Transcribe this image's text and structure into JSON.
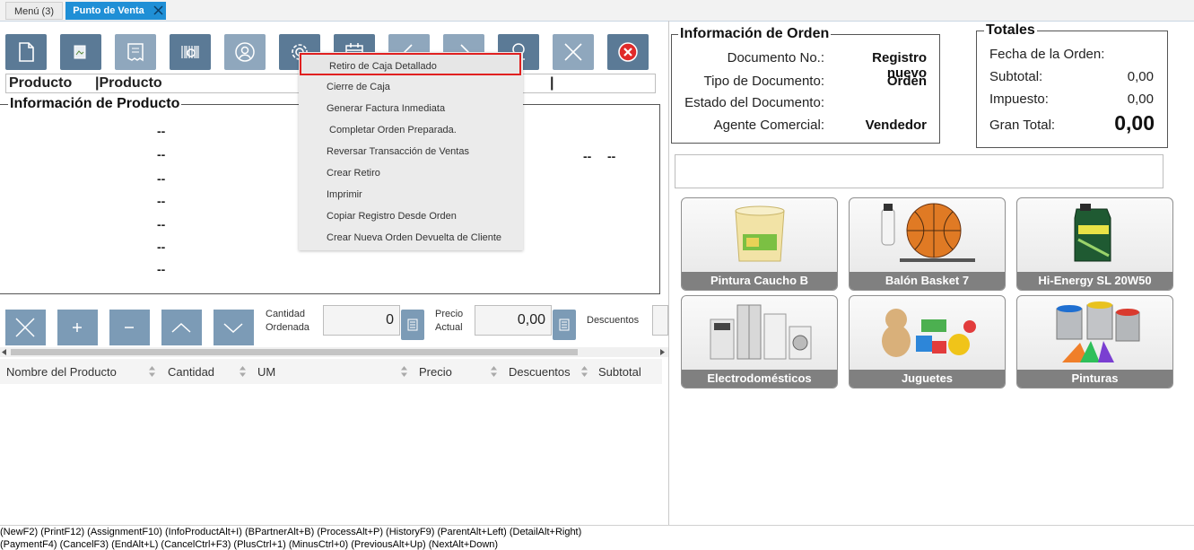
{
  "tabs": {
    "menu": "Menú (3)",
    "pos": "Punto de Venta"
  },
  "product_line": {
    "left": "Producto",
    "right": "Producto"
  },
  "product_info": {
    "title": "Información de Producto",
    "dash": "--"
  },
  "popup_menu": [
    "Retiro de Caja Detallado",
    "Cierre de Caja",
    "Generar Factura Inmediata",
    "Completar Orden Preparada.",
    "Reversar Transacción de Ventas",
    "Crear Retiro",
    "Imprimir",
    "Copiar Registro Desde Orden",
    "Crear Nueva Orden Devuelta de Cliente"
  ],
  "qty": {
    "label1": "Cantidad",
    "label2": "Ordenada",
    "value": "0"
  },
  "price": {
    "label1": "Precio",
    "label2": "Actual",
    "value": "0,00"
  },
  "discount": {
    "label": "Descuentos"
  },
  "table": {
    "headers": [
      "Nombre del Producto",
      "Cantidad",
      "UM",
      "Precio",
      "Descuentos",
      "Subtotal"
    ]
  },
  "order_info": {
    "title": "Información de Orden",
    "doc_no_label": "Documento No.:",
    "doc_no_value": "Registro nuevo",
    "doc_type_label": "Tipo de Documento:",
    "doc_type_value": "Orden",
    "status_label": "Estado del Documento:",
    "status_value": "",
    "agent_label": "Agente Comercial:",
    "agent_value": "Vendedor"
  },
  "totals": {
    "title": "Totales",
    "date_label": "Fecha de la Orden:",
    "date_value": "",
    "subtotal_label": "Subtotal:",
    "subtotal_value": "0,00",
    "tax_label": "Impuesto:",
    "tax_value": "0,00",
    "grand_label": "Gran Total:",
    "grand_value": "0,00"
  },
  "products": [
    "Pintura Caucho B",
    "Balón Basket 7",
    "Hi-Energy SL 20W50",
    "Electrodomésticos",
    "Juguetes",
    "Pinturas"
  ],
  "footer": {
    "line1": "(NewF2) (PrintF12) (AssignmentF10) (InfoProductAlt+I) (BPartnerAlt+B) (ProcessAlt+P) (HistoryF9) (ParentAlt+Left) (DetailAlt+Right)",
    "line2": "(PaymentF4) (CancelF3) (EndAlt+L) (CancelCtrl+F3) (PlusCtrl+1) (MinusCtrl+0) (PreviousAlt+Up) (NextAlt+Down)"
  },
  "colors": {
    "accent": "#1f8fd6",
    "toolbar": "#5b7a96",
    "highlight": "#e02020",
    "caption": "#808080"
  }
}
